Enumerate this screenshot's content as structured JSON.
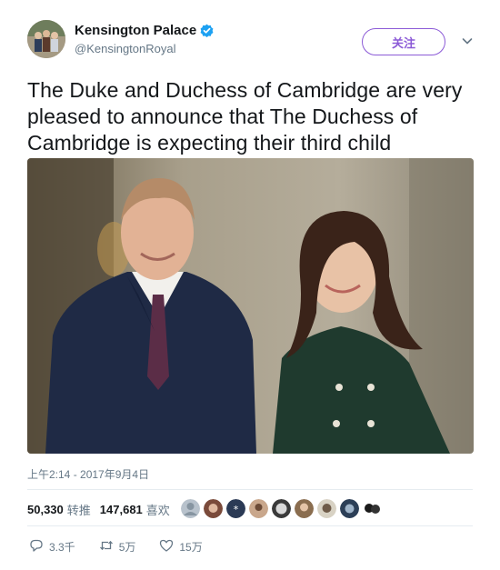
{
  "author": {
    "display_name": "Kensington Palace",
    "handle": "@KensingtonRoyal",
    "verified_color": "#1da1f2"
  },
  "follow_label": "关注",
  "tweet": {
    "text": "The Duke and Duchess of Cambridge are very pleased to announce that The Duchess of Cambridge is expecting their third child",
    "timestamp": "上午2:14 - 2017年9月4日"
  },
  "stats": {
    "retweets_count": "50,330",
    "retweets_label": "转推",
    "likes_count": "147,681",
    "likes_label": "喜欢"
  },
  "liker_avatars": 9,
  "actions": {
    "reply_count": "3.3千",
    "retweet_count": "5万",
    "like_count": "15万"
  },
  "colors": {
    "accent": "#8c5bd7",
    "text": "#14171a",
    "secondary": "#657786"
  },
  "icons": [
    "verified-icon",
    "chevron-down-icon",
    "reply-icon",
    "retweet-icon",
    "heart-icon"
  ]
}
